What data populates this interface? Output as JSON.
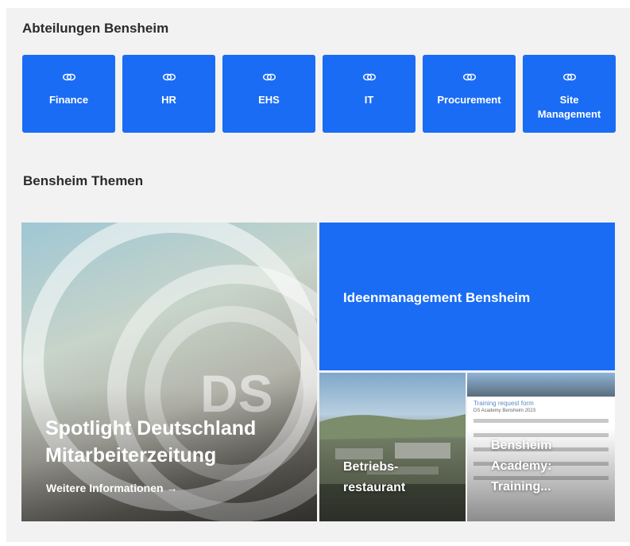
{
  "departments": {
    "title": "Abteilungen Bensheim",
    "tiles": [
      {
        "label": "Finance",
        "icon": "link-icon"
      },
      {
        "label": "HR",
        "icon": "link-icon"
      },
      {
        "label": "EHS",
        "icon": "link-icon"
      },
      {
        "label": "IT",
        "icon": "link-icon"
      },
      {
        "label": "Procurement",
        "icon": "link-icon"
      },
      {
        "label": "Site Management",
        "icon": "link-icon"
      }
    ]
  },
  "topics": {
    "title": "Bensheim Themen",
    "hero": {
      "title": "Spotlight Deutschland Mitarbeiterzeitung",
      "more_label": "Weitere Informationen",
      "arrow": "→",
      "logo_text": "DS"
    },
    "ideas_tile": {
      "label": "Ideenmanagement Bensheim"
    },
    "restaurant_tile": {
      "label": "Betriebs-restaurant"
    },
    "academy_tile": {
      "label": "Bensheim Academy: Training...",
      "form_title": "Training request form",
      "form_subtitle": "DS Academy Bensheim 2023"
    }
  },
  "colors": {
    "accent": "#1a6cf5",
    "panel_bg": "#f2f2f2",
    "heading": "#2b2b2b"
  }
}
